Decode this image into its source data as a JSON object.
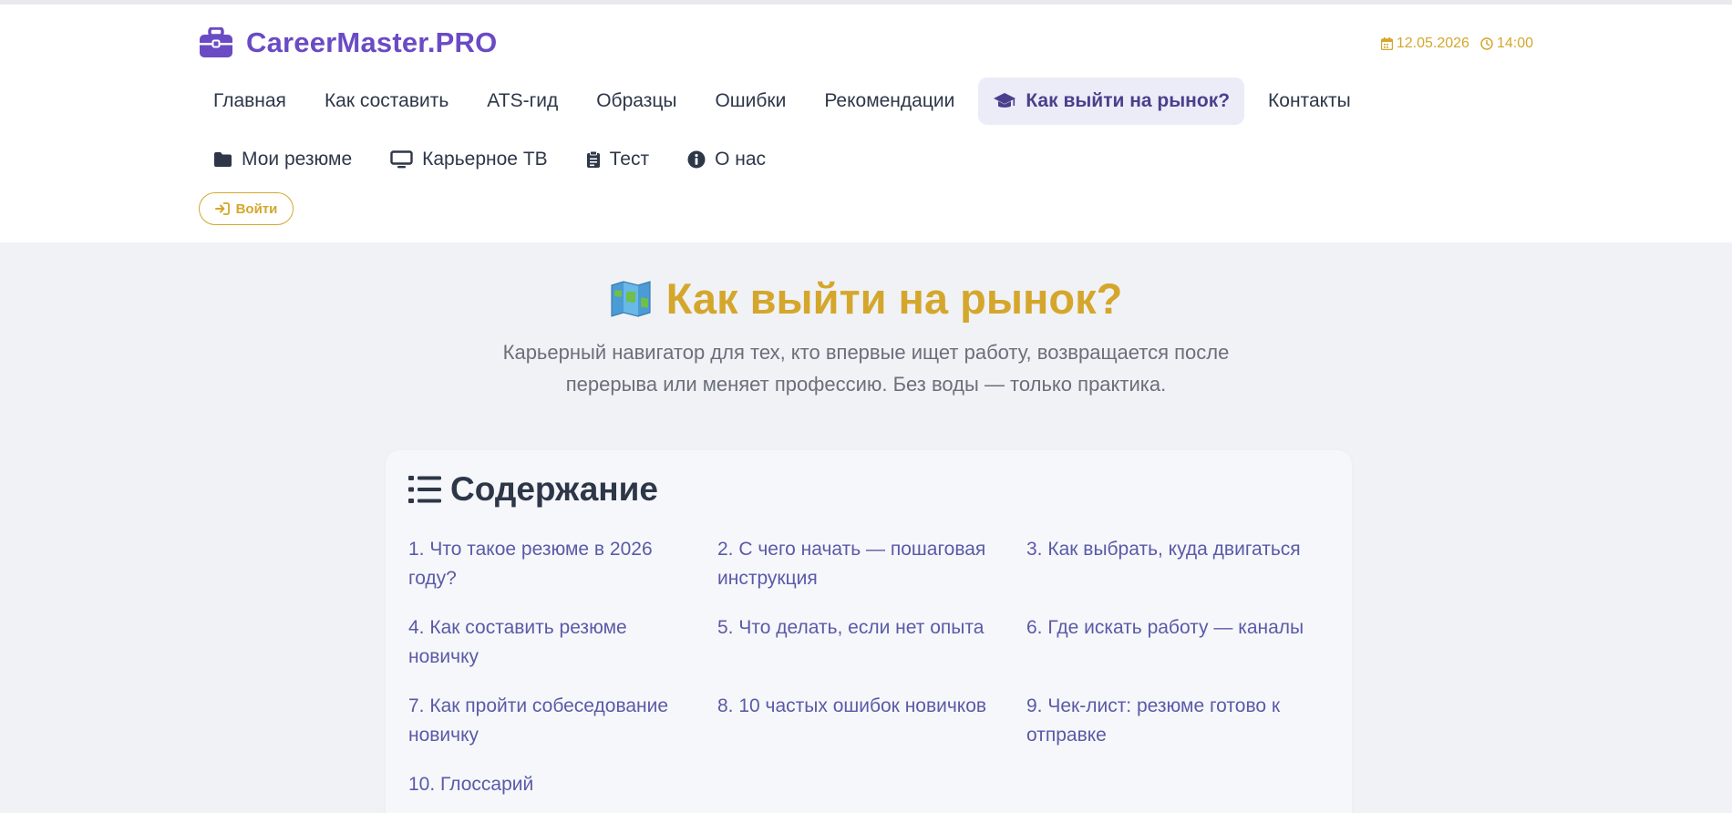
{
  "brand": {
    "name": "CareerMaster.PRO",
    "icon": "briefcase-icon",
    "color": "#6a4bc4"
  },
  "datetime": {
    "date": "12.05.2026",
    "time": "14:00",
    "color": "#d4a72c"
  },
  "nav": {
    "row1": [
      {
        "label": "Главная"
      },
      {
        "label": "Как составить"
      },
      {
        "label": "ATS-гид"
      },
      {
        "label": "Образцы"
      },
      {
        "label": "Ошибки"
      },
      {
        "label": "Рекомендации"
      },
      {
        "label": "Как выйти на рынок?",
        "icon": "graduation-cap-icon",
        "active": true
      },
      {
        "label": "Контакты"
      }
    ],
    "row2": [
      {
        "label": "Мои резюме",
        "icon": "folder-icon"
      },
      {
        "label": "Карьерное ТВ",
        "icon": "monitor-icon"
      },
      {
        "label": "Тест",
        "icon": "clipboard-icon"
      },
      {
        "label": "О нас",
        "icon": "info-icon"
      }
    ]
  },
  "login": {
    "label": "Войти",
    "icon": "sign-in-icon"
  },
  "hero": {
    "icon": "map-icon",
    "title": "Как выйти на рынок?",
    "subtitle_line1": "Карьерный навигатор для тех, кто впервые ищет работу, возвращается после",
    "subtitle_line2": "перерыва или меняет профессию. Без воды — только практика."
  },
  "toc": {
    "title": "Содержание",
    "icon": "list-icon",
    "items": [
      "1. Что такое резюме в 2026 году?",
      "2. С чего начать — пошаговая инструкция",
      "3. Как выбрать, куда двигаться",
      "4. Как составить резюме новичку",
      "5. Что делать, если нет опыта",
      "6. Где искать работу — каналы",
      "7. Как пройти собеседование новичку",
      "8. 10 частых ошибок новичков",
      "9. Чек-лист: резюме готово к отправке",
      "10. Глоссарий"
    ]
  },
  "colors": {
    "accent": "#d4a72c",
    "link": "#5a5aa8",
    "background": "#f1f2f6"
  }
}
